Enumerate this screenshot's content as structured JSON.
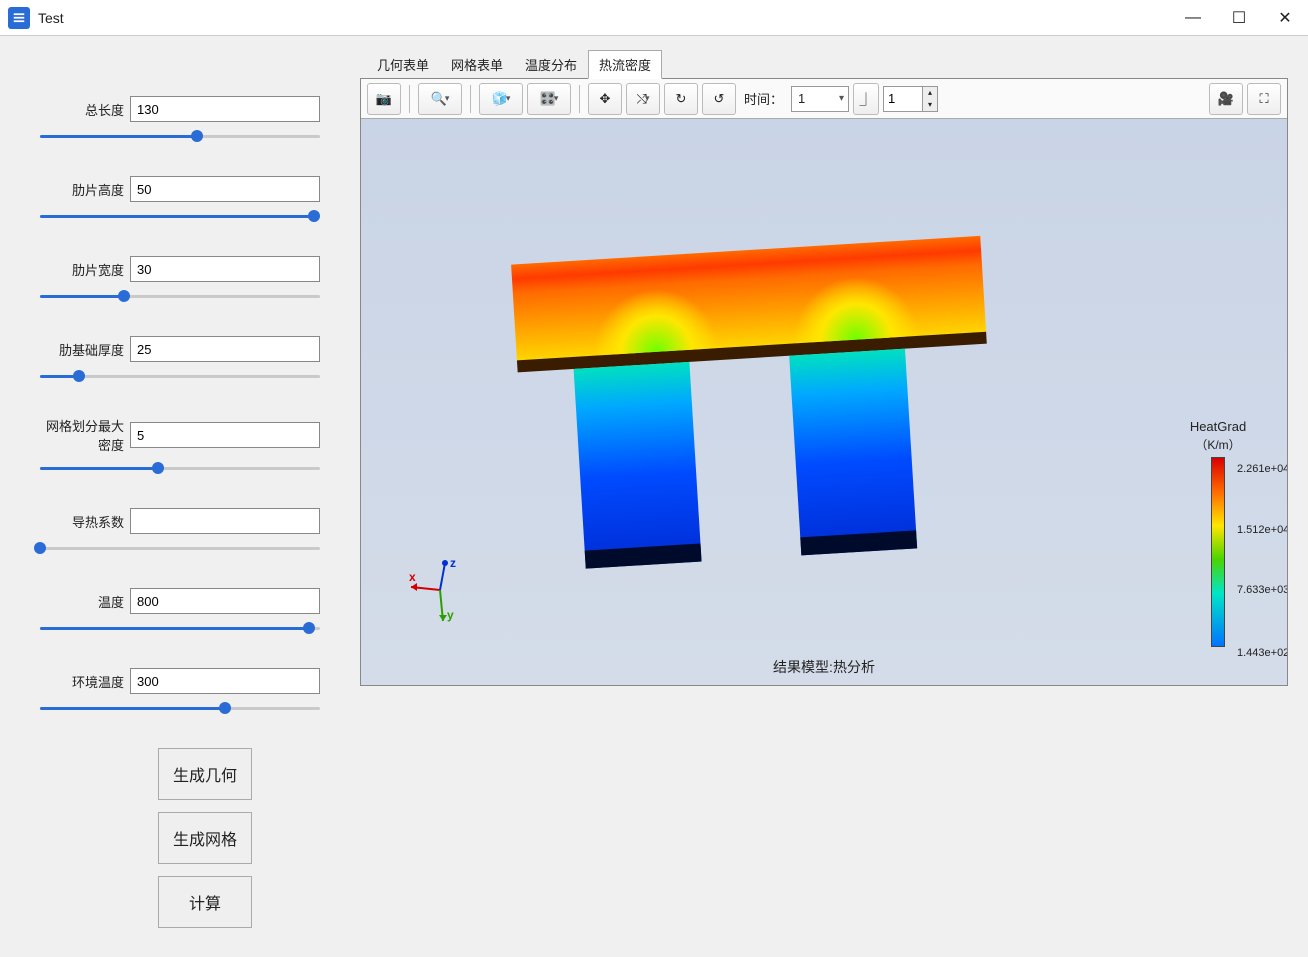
{
  "window": {
    "title": "Test"
  },
  "params": [
    {
      "key": "total_length",
      "label": "总长度",
      "value": "130",
      "fill": 56
    },
    {
      "key": "fin_height",
      "label": "肋片高度",
      "value": "50",
      "fill": 98
    },
    {
      "key": "fin_width",
      "label": "肋片宽度",
      "value": "30",
      "fill": 30
    },
    {
      "key": "fin_base_thk",
      "label": "肋基础厚度",
      "value": "25",
      "fill": 14
    },
    {
      "key": "mesh_density",
      "label": "网格划分最大密度",
      "value": "5",
      "fill": 42
    },
    {
      "key": "conductivity",
      "label": "导热系数",
      "value": "",
      "fill": 0
    },
    {
      "key": "temperature",
      "label": "温度",
      "value": "800",
      "fill": 96
    },
    {
      "key": "ambient_temp",
      "label": "环境温度",
      "value": "300",
      "fill": 66
    }
  ],
  "buttons": {
    "gen_geometry": "生成几何",
    "gen_mesh": "生成网格",
    "compute": "计算"
  },
  "tabs": [
    "几何表单",
    "网格表单",
    "温度分布",
    "热流密度"
  ],
  "active_tab": 3,
  "toolbar": {
    "time_label": "时间：",
    "time_value": "1",
    "step_value": "1"
  },
  "viewport": {
    "result_label": "结果模型:热分析",
    "axes": {
      "x": "x",
      "y": "y",
      "z": "z"
    }
  },
  "legend": {
    "title": "HeatGrad",
    "unit": "（K/m）",
    "ticks": [
      {
        "label": "2.261e+04",
        "pos": 0
      },
      {
        "label": "1.512e+04",
        "pos": 33
      },
      {
        "label": "7.633e+03",
        "pos": 66
      },
      {
        "label": "1.443e+02",
        "pos": 100
      }
    ]
  },
  "chart_data": {
    "type": "heatmap",
    "title": "结果模型:热分析",
    "field": "HeatGrad",
    "unit": "K/m",
    "range_min": 144.3,
    "range_max": 22610,
    "colormap": "rainbow",
    "ticks": [
      22610,
      15120,
      7633,
      144.3
    ]
  }
}
